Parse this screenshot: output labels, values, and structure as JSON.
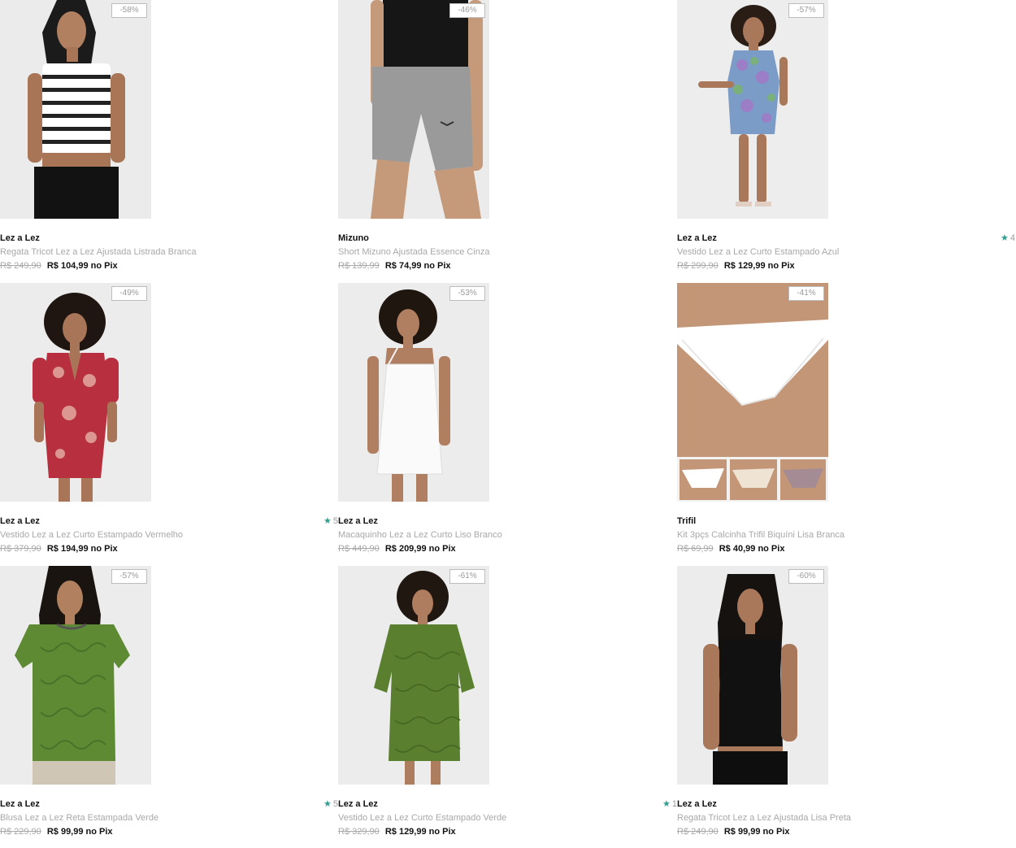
{
  "products": [
    {
      "brand": "Lez a Lez",
      "name": "Regata Tricot Lez a Lez Ajustada Listrada Branca",
      "old_price": "R$ 249,90",
      "price": "R$ 104,99",
      "pix": "no Pix",
      "discount": "-58%",
      "rating": ""
    },
    {
      "brand": "Mizuno",
      "name": "Short Mizuno Ajustada Essence Cinza",
      "old_price": "R$ 139,99",
      "price": "R$ 74,99",
      "pix": "no Pix",
      "discount": "-46%",
      "rating": ""
    },
    {
      "brand": "Lez a Lez",
      "name": "Vestido Lez a Lez Curto Estampado Azul",
      "old_price": "R$ 299,90",
      "price": "R$ 129,99",
      "pix": "no Pix",
      "discount": "-57%",
      "rating": "4"
    },
    {
      "brand": "Lez a Lez",
      "name": "Vestido Lez a Lez Curto Estampado Vermelho",
      "old_price": "R$ 379,90",
      "price": "R$ 194,99",
      "pix": "no Pix",
      "discount": "-49%",
      "rating": ""
    },
    {
      "brand": "Lez a Lez",
      "name": "Macaquinho Lez a Lez Curto Liso Branco",
      "old_price": "R$ 449,90",
      "price": "R$ 209,99",
      "pix": "no Pix",
      "discount": "-53%",
      "rating": "5"
    },
    {
      "brand": "Trifil",
      "name": "Kit 3pçs Calcinha Trifil Biquíni Lisa Branca",
      "old_price": "R$ 69,99",
      "price": "R$ 40,99",
      "pix": "no Pix",
      "discount": "-41%",
      "rating": ""
    },
    {
      "brand": "Lez a Lez",
      "name": "Blusa Lez a Lez Reta Estampada Verde",
      "old_price": "R$ 229,90",
      "price": "R$ 99,99",
      "pix": "no Pix",
      "discount": "-57%",
      "rating": ""
    },
    {
      "brand": "Lez a Lez",
      "name": "Vestido Lez a Lez Curto Estampado Verde",
      "old_price": "R$ 329,90",
      "price": "R$ 129,99",
      "pix": "no Pix",
      "discount": "-61%",
      "rating": "5"
    },
    {
      "brand": "Lez a Lez",
      "name": "Regata Tricot Lez a Lez Ajustada Lisa Preta",
      "old_price": "R$ 249,90",
      "price": "R$ 99,99",
      "pix": "no Pix",
      "discount": "-60%",
      "rating": "1"
    }
  ],
  "icons": {
    "rating": "star-icon"
  },
  "colors": {
    "rating_star": "#2f9e8f",
    "muted_text": "#a8a8a8",
    "price_text": "#111111"
  }
}
